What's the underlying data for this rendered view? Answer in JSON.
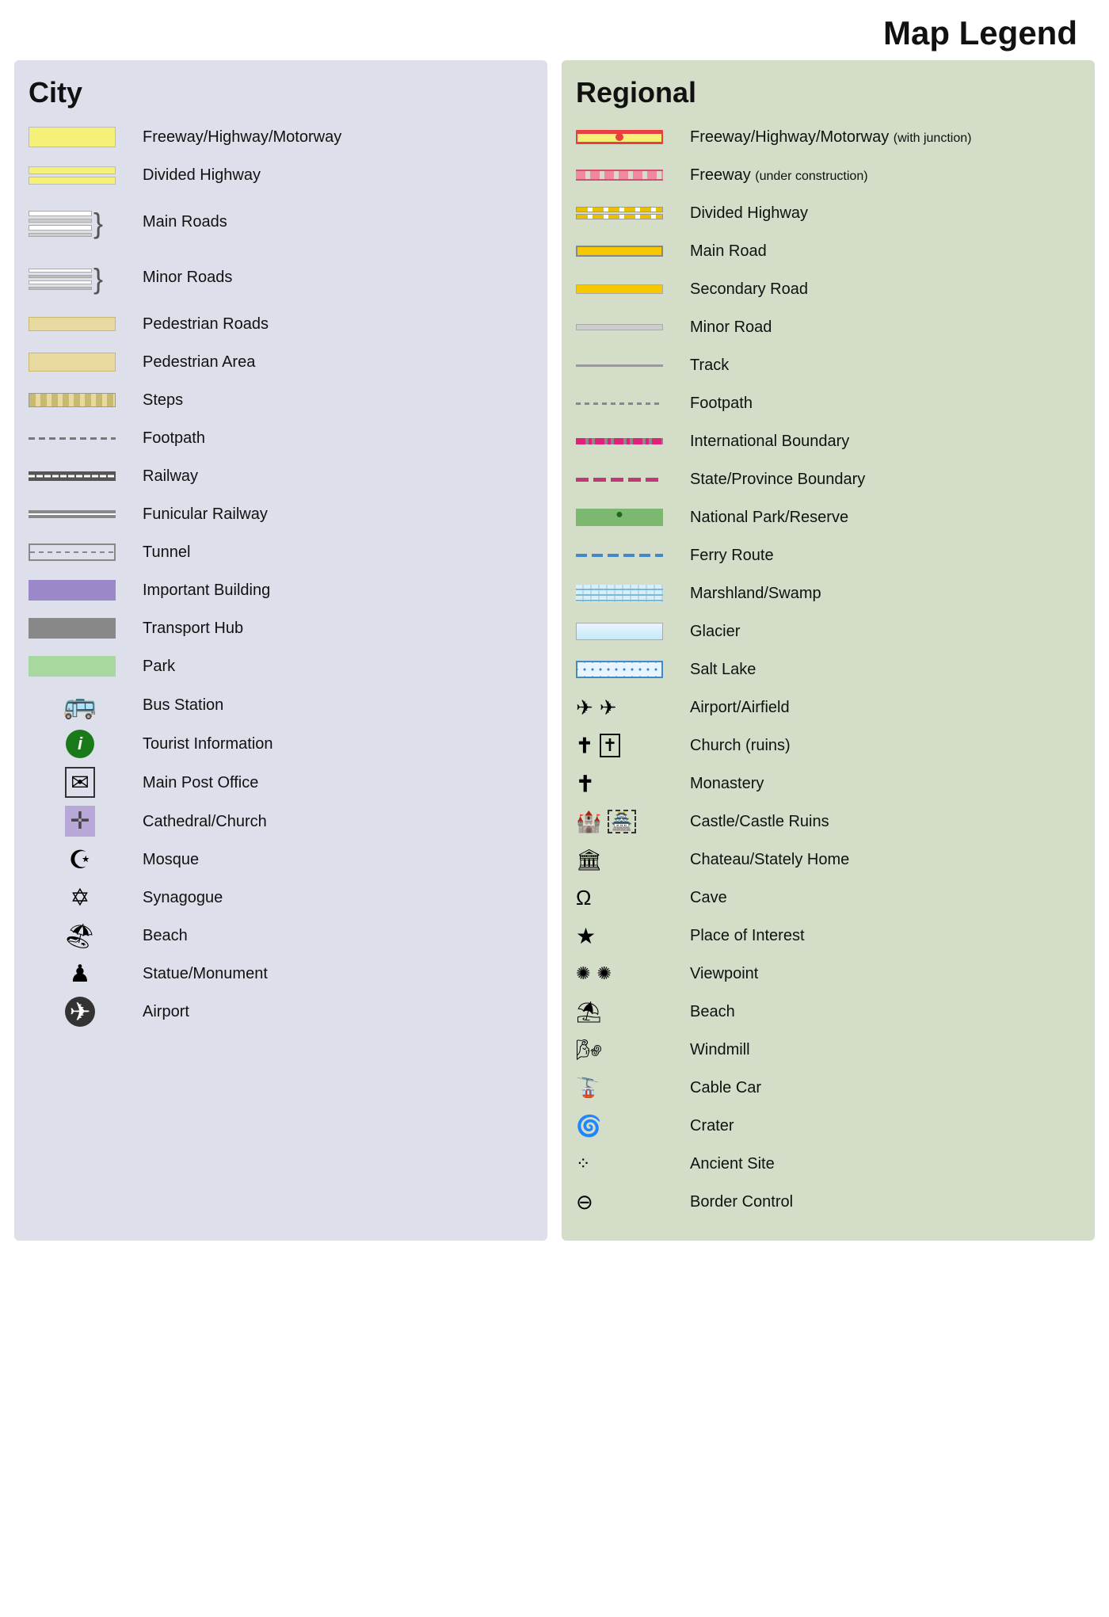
{
  "title": "Map Legend",
  "city": {
    "heading": "City",
    "items": [
      {
        "label": "Freeway/Highway/Motorway",
        "type": "freeway-city"
      },
      {
        "label": "Divided Highway",
        "type": "divided-city"
      },
      {
        "label": "Main Roads",
        "type": "main-roads"
      },
      {
        "label": "Minor Roads",
        "type": "minor-roads"
      },
      {
        "label": "Pedestrian Roads",
        "type": "pedestrian-road"
      },
      {
        "label": "Pedestrian Area",
        "type": "pedestrian-area"
      },
      {
        "label": "Steps",
        "type": "steps"
      },
      {
        "label": "Footpath",
        "type": "footpath-city"
      },
      {
        "label": "Railway",
        "type": "railway"
      },
      {
        "label": "Funicular Railway",
        "type": "funicular"
      },
      {
        "label": "Tunnel",
        "type": "tunnel"
      },
      {
        "label": "Important Building",
        "type": "important-bldg"
      },
      {
        "label": "Transport Hub",
        "type": "transport-hub"
      },
      {
        "label": "Park",
        "type": "park"
      },
      {
        "label": "Bus Station",
        "type": "bus-icon",
        "icon": "🚌"
      },
      {
        "label": "Tourist Information",
        "type": "info-icon"
      },
      {
        "label": "Main Post Office",
        "type": "post-icon",
        "icon": "✉"
      },
      {
        "label": "Cathedral/Church",
        "type": "church-icon"
      },
      {
        "label": "Mosque",
        "type": "mosque-icon",
        "icon": "☪"
      },
      {
        "label": "Synagogue",
        "type": "synagogue-icon",
        "icon": "✡"
      },
      {
        "label": "Beach",
        "type": "beach-icon",
        "icon": "𝕡"
      },
      {
        "label": "Statue/Monument",
        "type": "statue-icon",
        "icon": "♟"
      },
      {
        "label": "Airport",
        "type": "airport-icon",
        "icon": "✈"
      }
    ]
  },
  "regional": {
    "heading": "Regional",
    "items": [
      {
        "label": "Freeway/Highway/Motorway (with junction)",
        "type": "reg-freeway-junction"
      },
      {
        "label": "Freeway (under construction)",
        "type": "reg-freeway-under"
      },
      {
        "label": "Divided Highway",
        "type": "reg-divided-hwy"
      },
      {
        "label": "Main Road",
        "type": "reg-main-road"
      },
      {
        "label": "Secondary Road",
        "type": "reg-secondary-road"
      },
      {
        "label": "Minor Road",
        "type": "reg-minor-road"
      },
      {
        "label": "Track",
        "type": "reg-track"
      },
      {
        "label": "Footpath",
        "type": "reg-footpath"
      },
      {
        "label": "International Boundary",
        "type": "reg-intl-boundary"
      },
      {
        "label": "State/Province Boundary",
        "type": "reg-state-boundary"
      },
      {
        "label": "National Park/Reserve",
        "type": "reg-national-park"
      },
      {
        "label": "Ferry Route",
        "type": "reg-ferry"
      },
      {
        "label": "Marshland/Swamp",
        "type": "reg-marshland"
      },
      {
        "label": "Glacier",
        "type": "reg-glacier"
      },
      {
        "label": "Salt Lake",
        "type": "reg-salt-lake"
      },
      {
        "label": "Airport/Airfield",
        "type": "reg-airport"
      },
      {
        "label": "Church (ruins)",
        "type": "reg-church-ruins"
      },
      {
        "label": "Monastery",
        "type": "reg-monastery",
        "icon": "✝"
      },
      {
        "label": "Castle/Castle Ruins",
        "type": "reg-castle"
      },
      {
        "label": "Chateau/Stately Home",
        "type": "reg-chateau"
      },
      {
        "label": "Cave",
        "type": "reg-cave"
      },
      {
        "label": "Place of Interest",
        "type": "reg-poi",
        "icon": "★"
      },
      {
        "label": "Viewpoint",
        "type": "reg-viewpoint"
      },
      {
        "label": "Beach",
        "type": "reg-beach"
      },
      {
        "label": "Windmill",
        "type": "reg-windmill"
      },
      {
        "label": "Cable Car",
        "type": "reg-cablecar"
      },
      {
        "label": "Crater",
        "type": "reg-crater"
      },
      {
        "label": "Ancient Site",
        "type": "reg-ancient"
      },
      {
        "label": "Border Control",
        "type": "reg-border",
        "icon": "⊖"
      }
    ]
  }
}
